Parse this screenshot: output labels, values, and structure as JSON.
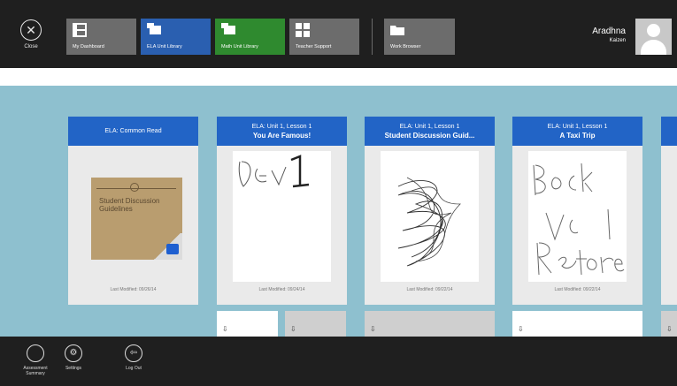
{
  "topbar": {
    "close": {
      "label": "Close",
      "icon": "close-icon"
    },
    "nav": [
      {
        "label": "My Dashboard",
        "icon": "dashboard-icon",
        "color": "#6c6c6c"
      },
      {
        "label": "ELA Unit Library",
        "icon": "library-icon",
        "color": "#2a5fb0"
      },
      {
        "label": "Math Unit Library",
        "icon": "library-icon",
        "color": "#2f8a2f"
      },
      {
        "label": "Teacher Support",
        "icon": "support-icon",
        "color": "#6c6c6c"
      },
      {
        "label": "Work Browser",
        "icon": "folder-icon",
        "color": "#6c6c6c"
      }
    ],
    "user": {
      "name": "Aradhna",
      "school": "Kaizen"
    }
  },
  "cards": [
    {
      "line1": "ELA: Common Read",
      "title": "",
      "modified": "Last Modified: 09/26/14"
    },
    {
      "line1": "ELA: Unit 1, Lesson 1",
      "title": "You Are Famous!",
      "modified": "Last Modified: 09/24/14"
    },
    {
      "line1": "ELA: Unit 1, Lesson 1",
      "title": "Student Discussion Guid...",
      "modified": "Last Modified: 09/22/14"
    },
    {
      "line1": "ELA: Unit 1, Lesson 1",
      "title": "A Taxi Trip",
      "modified": "Last Modified: 09/22/14"
    }
  ],
  "thumb1": {
    "text": "Student Discussion Guidelines"
  },
  "bottombar": {
    "buttons": [
      {
        "label": "Assessment Summary",
        "icon": "circle-icon"
      },
      {
        "label": "Settings",
        "icon": "gear-icon"
      },
      {
        "label": "Log Out",
        "icon": "logout-icon"
      }
    ]
  }
}
